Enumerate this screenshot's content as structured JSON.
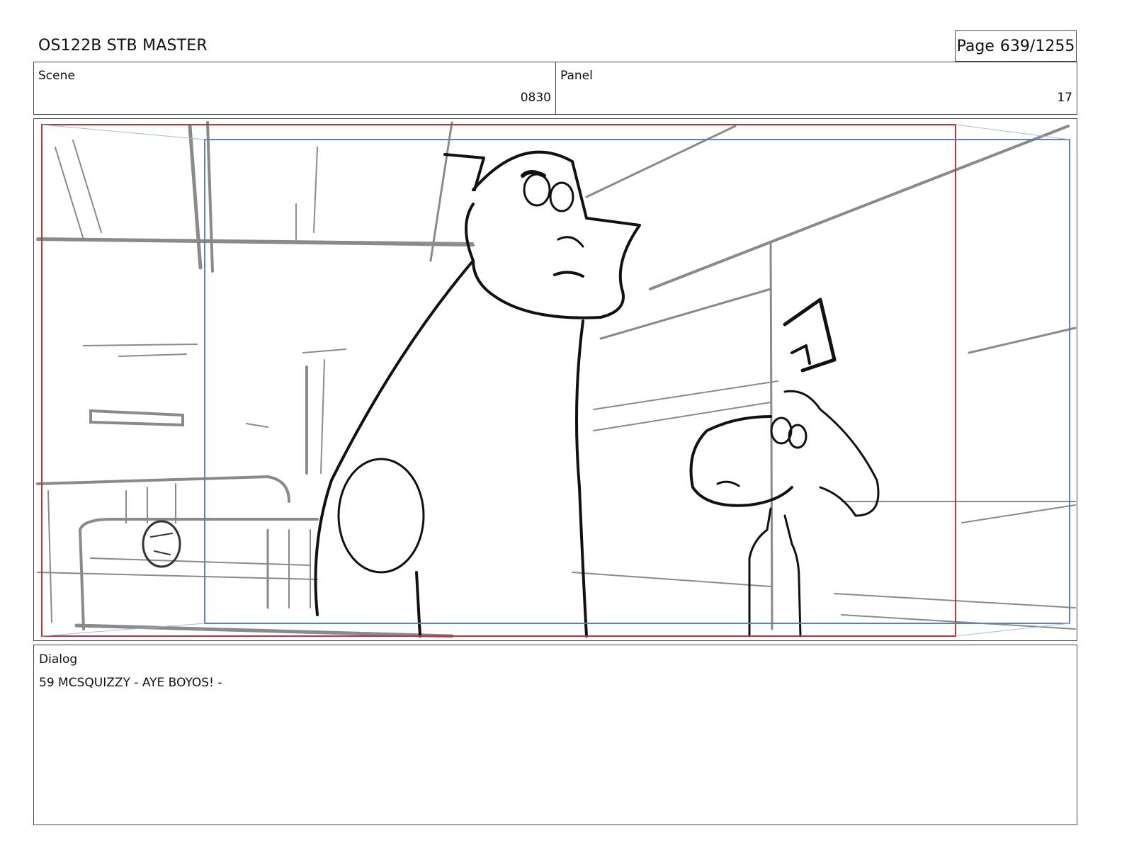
{
  "header": {
    "title": "OS122B STB MASTER",
    "page_label": "Page",
    "page_value": "639/1255"
  },
  "scene": {
    "label": "Scene",
    "value": "0830"
  },
  "panel": {
    "label": "Panel",
    "value": "17"
  },
  "artwork": {
    "description_icon": "storyboard-sketch",
    "safe_frame_color": "#c0303a",
    "camera_frame_color": "#5b82b8",
    "ink_color": "#111111",
    "sketch_color": "#8a8a8a"
  },
  "dialog": {
    "label": "Dialog",
    "text": "59 MCSQUIZZY - AYE BOYOS! -"
  }
}
